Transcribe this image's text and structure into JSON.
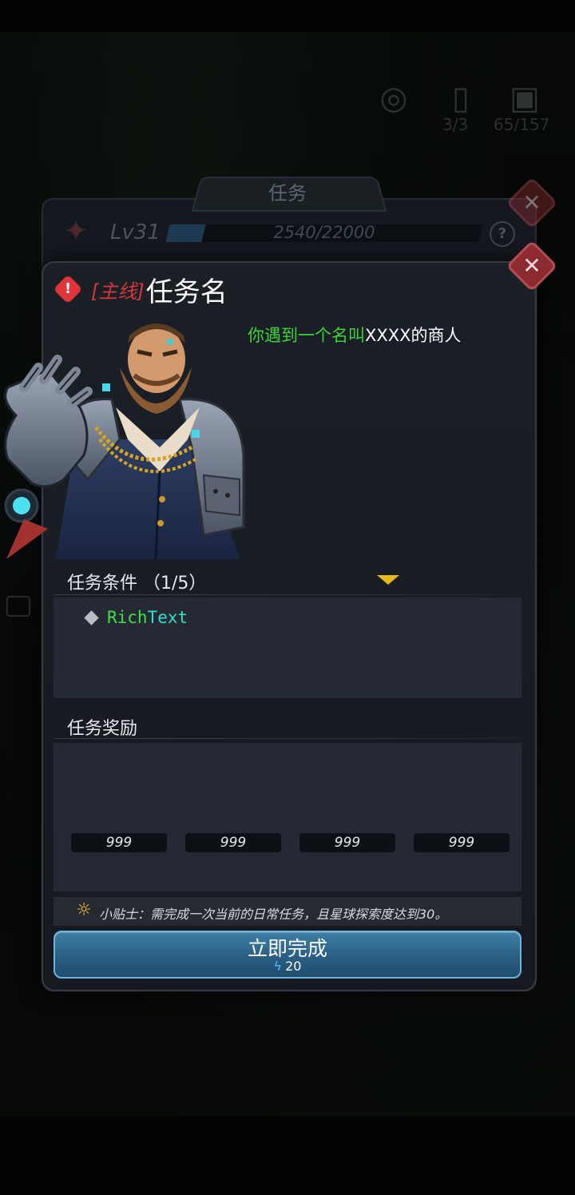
{
  "topbar": {
    "items": [
      {
        "icon": "radar-icon",
        "count": ""
      },
      {
        "icon": "door-icon",
        "count": "3/3"
      },
      {
        "icon": "calendar-icon",
        "count": "65/157"
      },
      {
        "icon": "gear-icon",
        "count": ""
      }
    ]
  },
  "back_panel": {
    "tab_label": "任务",
    "level": "Lv31",
    "xp_text": "2540/22000",
    "xp_fraction": 0.115,
    "help": "?"
  },
  "dialog": {
    "alert": "!",
    "title_tag": "[主线]",
    "title_name": "任务名",
    "description_highlight": "你遇到一个名叫",
    "description_rest": "XXXX的商人",
    "conditions_title": "任务条件",
    "conditions_count": "（1/5）",
    "condition_rich_part": "Rich",
    "condition_text_part": "Text",
    "rewards_title": "任务奖励",
    "reward_slots": [
      "999",
      "999",
      "999",
      "999"
    ],
    "tip_text": "小贴士：需完成一次当前的日常任务，且星球探索度达到30。",
    "action_label": "立即完成",
    "action_cost": "20"
  },
  "colors": {
    "accent_green": "#3cd23c",
    "title_tag_red": "#d8373d",
    "button_blue": "#2a5f83",
    "arrow_yellow": "#e4b820"
  }
}
